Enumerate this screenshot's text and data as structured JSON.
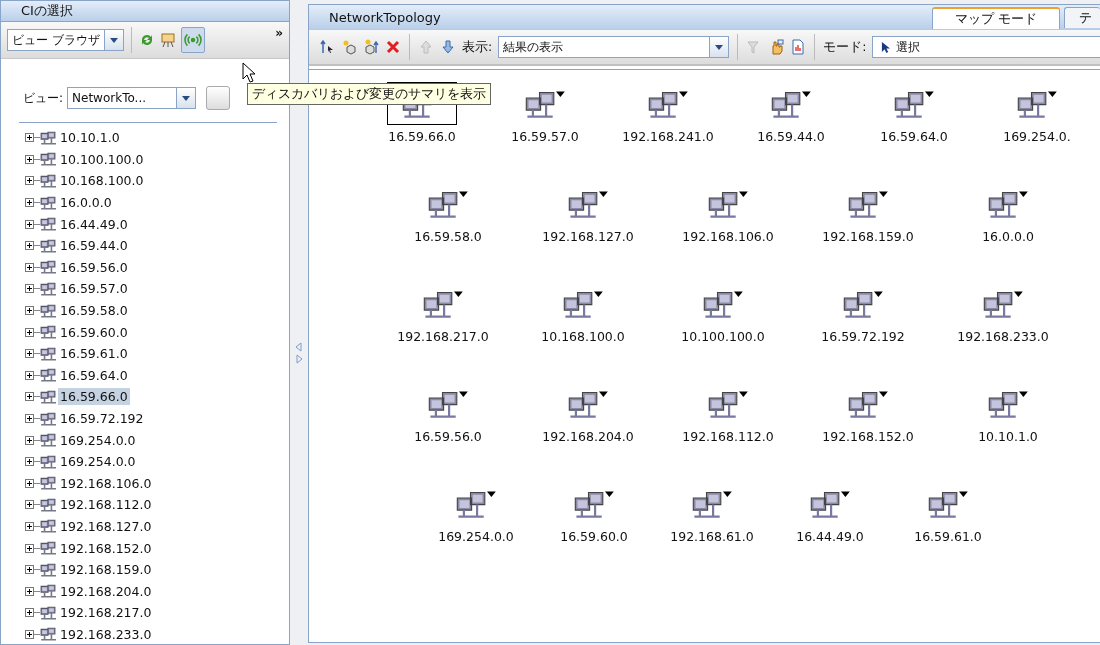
{
  "left_panel": {
    "title": "CIの選択",
    "browser_select": {
      "value": "ビュー ブラウザ"
    },
    "toolbar_more": "»",
    "view_label": "ビュー:",
    "view_select": {
      "value": "NetworkTo..."
    },
    "tree": [
      {
        "label": "10.10.1.0",
        "expanded": false,
        "selected": false
      },
      {
        "label": "10.100.100.0",
        "expanded": false,
        "selected": false
      },
      {
        "label": "10.168.100.0",
        "expanded": false,
        "selected": false
      },
      {
        "label": "16.0.0.0",
        "expanded": false,
        "selected": false
      },
      {
        "label": "16.44.49.0",
        "expanded": false,
        "selected": false
      },
      {
        "label": "16.59.44.0",
        "expanded": false,
        "selected": false
      },
      {
        "label": "16.59.56.0",
        "expanded": false,
        "selected": false
      },
      {
        "label": "16.59.57.0",
        "expanded": false,
        "selected": false
      },
      {
        "label": "16.59.58.0",
        "expanded": false,
        "selected": false
      },
      {
        "label": "16.59.60.0",
        "expanded": false,
        "selected": false
      },
      {
        "label": "16.59.61.0",
        "expanded": false,
        "selected": false
      },
      {
        "label": "16.59.64.0",
        "expanded": false,
        "selected": false
      },
      {
        "label": "16.59.66.0",
        "expanded": false,
        "selected": true
      },
      {
        "label": "16.59.72.192",
        "expanded": false,
        "selected": false
      },
      {
        "label": "169.254.0.0",
        "expanded": false,
        "selected": false
      },
      {
        "label": "169.254.0.0",
        "expanded": false,
        "selected": false
      },
      {
        "label": "192.168.106.0",
        "expanded": false,
        "selected": false
      },
      {
        "label": "192.168.112.0",
        "expanded": false,
        "selected": false
      },
      {
        "label": "192.168.127.0",
        "expanded": false,
        "selected": false
      },
      {
        "label": "192.168.152.0",
        "expanded": false,
        "selected": false
      },
      {
        "label": "192.168.159.0",
        "expanded": false,
        "selected": false
      },
      {
        "label": "192.168.204.0",
        "expanded": false,
        "selected": false
      },
      {
        "label": "192.168.217.0",
        "expanded": false,
        "selected": false
      },
      {
        "label": "192.168.233.0",
        "expanded": false,
        "selected": false
      }
    ]
  },
  "tooltip": "ディスカバリおよび変更のサマリを表示",
  "right_panel": {
    "title": "NetworkTopology",
    "tabs": [
      {
        "label": "マップ モード",
        "selected": true
      },
      {
        "label": "テ",
        "selected": false
      }
    ],
    "show_label": "表示:",
    "show_select": {
      "value": "結果の表示"
    },
    "mode_label": "モード:",
    "mode_select": {
      "value": "選択"
    },
    "map_rows": [
      [
        {
          "label": "16.59.66.0",
          "selected": true
        },
        {
          "label": "16.59.57.0",
          "selected": false
        },
        {
          "label": "192.168.241.0",
          "selected": false
        },
        {
          "label": "16.59.44.0",
          "selected": false
        },
        {
          "label": "16.59.64.0",
          "selected": false
        },
        {
          "label": "169.254.0.",
          "selected": false
        }
      ],
      [
        {
          "label": "16.59.58.0",
          "selected": false
        },
        {
          "label": "192.168.127.0",
          "selected": false
        },
        {
          "label": "192.168.106.0",
          "selected": false
        },
        {
          "label": "192.168.159.0",
          "selected": false
        },
        {
          "label": "16.0.0.0",
          "selected": false
        }
      ],
      [
        {
          "label": "192.168.217.0",
          "selected": false
        },
        {
          "label": "10.168.100.0",
          "selected": false
        },
        {
          "label": "10.100.100.0",
          "selected": false
        },
        {
          "label": "16.59.72.192",
          "selected": false
        },
        {
          "label": "192.168.233.0",
          "selected": false
        }
      ],
      [
        {
          "label": "16.59.56.0",
          "selected": false
        },
        {
          "label": "192.168.204.0",
          "selected": false
        },
        {
          "label": "192.168.112.0",
          "selected": false
        },
        {
          "label": "192.168.152.0",
          "selected": false
        },
        {
          "label": "10.10.1.0",
          "selected": false
        }
      ],
      [
        {
          "label": "169.254.0.0",
          "selected": false
        },
        {
          "label": "16.59.60.0",
          "selected": false
        },
        {
          "label": "192.168.61.0",
          "selected": false
        },
        {
          "label": "16.44.49.0",
          "selected": false
        },
        {
          "label": "16.59.61.0",
          "selected": false
        }
      ]
    ]
  }
}
